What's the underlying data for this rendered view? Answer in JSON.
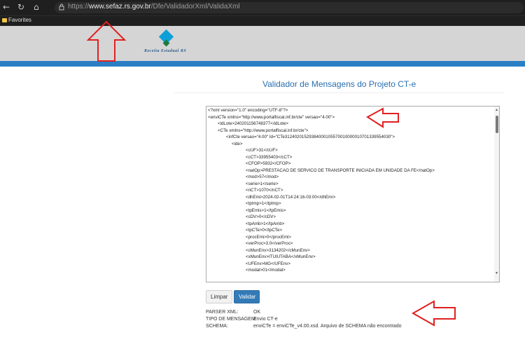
{
  "browser": {
    "url_prefix": "https://",
    "url_host": "www.sefaz.rs.gov.br",
    "url_path": "/Dfe/ValidadorXml/ValidaXml",
    "favorites_label": "Favorites"
  },
  "header": {
    "logo_text": "Receita Estadual RS",
    "accent_color": "#2a7fc4"
  },
  "page": {
    "title": "Validador de Mensagens do Projeto CT-e"
  },
  "xml_lines": [
    {
      "indent": 0,
      "text": "<?xml version=\"1.0\" encoding=\"UTF-8\"?>"
    },
    {
      "indent": 0,
      "text": "<enviCTe xmlns=\"http://www.portalfiscal.inf.br/cte\" versao=\"4.00\">"
    },
    {
      "indent": 1,
      "text": "<idLote>240201156748377</idLote>"
    },
    {
      "indent": 1,
      "text": "<CTe xmlns=\"http://www.portalfiscal.inf.br/cte\">"
    },
    {
      "indent": 2,
      "text": "<infCte versao=\"4.00\" Id=\"CTe31240201529384000105570010000010701339554030\">"
    },
    {
      "indent": 3,
      "text": "<ide>"
    },
    {
      "indent": 4,
      "text": "<cUF>31</cUF>"
    },
    {
      "indent": 4,
      "text": "<cCT>33955403</cCT>"
    },
    {
      "indent": 4,
      "text": "<CFOP>5932</CFOP>"
    },
    {
      "indent": 4,
      "text": "<natOp>PRESTACAO DE SERVICO DE TRANSPORTE INICIADA EM UNIDADE DA FE</natOp>"
    },
    {
      "indent": 4,
      "text": "<mod>57</mod>"
    },
    {
      "indent": 4,
      "text": "<serie>1</serie>"
    },
    {
      "indent": 4,
      "text": "<nCT>1070</nCT>"
    },
    {
      "indent": 4,
      "text": "<dhEmi>2024-02-01T14:24:16-03:00</dhEmi>"
    },
    {
      "indent": 4,
      "text": "<tpImp>1</tpImp>"
    },
    {
      "indent": 4,
      "text": "<tpEmis>1</tpEmis>"
    },
    {
      "indent": 4,
      "text": "<cDV>0</cDV>"
    },
    {
      "indent": 4,
      "text": "<tpAmb>1</tpAmb>"
    },
    {
      "indent": 4,
      "text": "<tpCTe>0</tpCTe>"
    },
    {
      "indent": 4,
      "text": "<procEmi>0</procEmi>"
    },
    {
      "indent": 4,
      "text": "<verProc>3.0</verProc>"
    },
    {
      "indent": 4,
      "text": "<cMunEnv>3134202</cMunEnv>"
    },
    {
      "indent": 4,
      "text": "<xMunEnv>ITUIUTABA</xMunEnv>"
    },
    {
      "indent": 4,
      "text": "<UFEnv>MG</UFEnv>"
    },
    {
      "indent": 4,
      "text": "<modal>01</modal>"
    }
  ],
  "buttons": {
    "limpar": "Limpar",
    "validar": "Validar"
  },
  "results": {
    "parser_label": "PARSER XML:",
    "parser_value": "OK",
    "tipo_label": "TIPO DE MENSAGEM:",
    "tipo_value": "Envio CT-e",
    "schema_label": "SCHEMA:",
    "schema_value": "enviCTe = enviCTe_v4.00.xsd. Arquivo de SCHEMA não encontrado"
  },
  "colors": {
    "title_blue": "#2a6fb0",
    "button_primary": "#337ab7",
    "annotation_red": "#e02020"
  }
}
